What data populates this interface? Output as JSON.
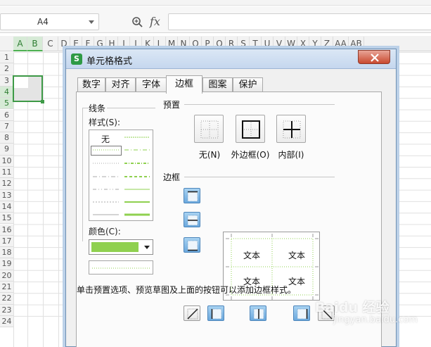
{
  "formula_bar": {
    "cell_reference": "A4",
    "fx_label": "fx",
    "formula_value": ""
  },
  "sheet": {
    "columns": [
      "A",
      "B",
      "C",
      "D",
      "E",
      "F",
      "G",
      "H",
      "I",
      "J",
      "K",
      "L",
      "M",
      "N",
      "O",
      "P",
      "Q",
      "R",
      "S",
      "T",
      "U",
      "V",
      "W",
      "X",
      "Y",
      "Z",
      "AA",
      "AB"
    ],
    "rows": [
      "1",
      "2",
      "3",
      "4",
      "5",
      "6",
      "7",
      "8",
      "9",
      "10",
      "11",
      "12",
      "13",
      "14",
      "15",
      "16",
      "17",
      "18",
      "19",
      "20",
      "21",
      "22",
      "23",
      "24"
    ],
    "selected_columns": [
      "A",
      "B"
    ],
    "selected_rows": [
      "4",
      "5"
    ],
    "selection_color": "#3e9a47"
  },
  "dialog": {
    "title": "单元格格式",
    "app_logo_letter": "S",
    "tabs": [
      "数字",
      "对齐",
      "字体",
      "边框",
      "图案",
      "保护"
    ],
    "active_tab": "边框",
    "line_section": {
      "title": "线条",
      "style_label": "样式(S):",
      "none_label": "无",
      "color_label": "颜色(C):",
      "color_value": "#8fd04f"
    },
    "presets_section": {
      "title": "预置",
      "none_label": "无(N)",
      "outline_label": "外边框(O)",
      "inside_label": "内部(I)"
    },
    "border_section": {
      "title": "边框",
      "preview_cell_text": [
        "文本",
        "文本",
        "文本",
        "文本"
      ]
    },
    "hint": "单击预置选项、预览草图及上面的按钮可以添加边框样式。"
  },
  "watermark": {
    "brand": "Baidu 经验",
    "sub": "jingyan.baidu.com"
  }
}
